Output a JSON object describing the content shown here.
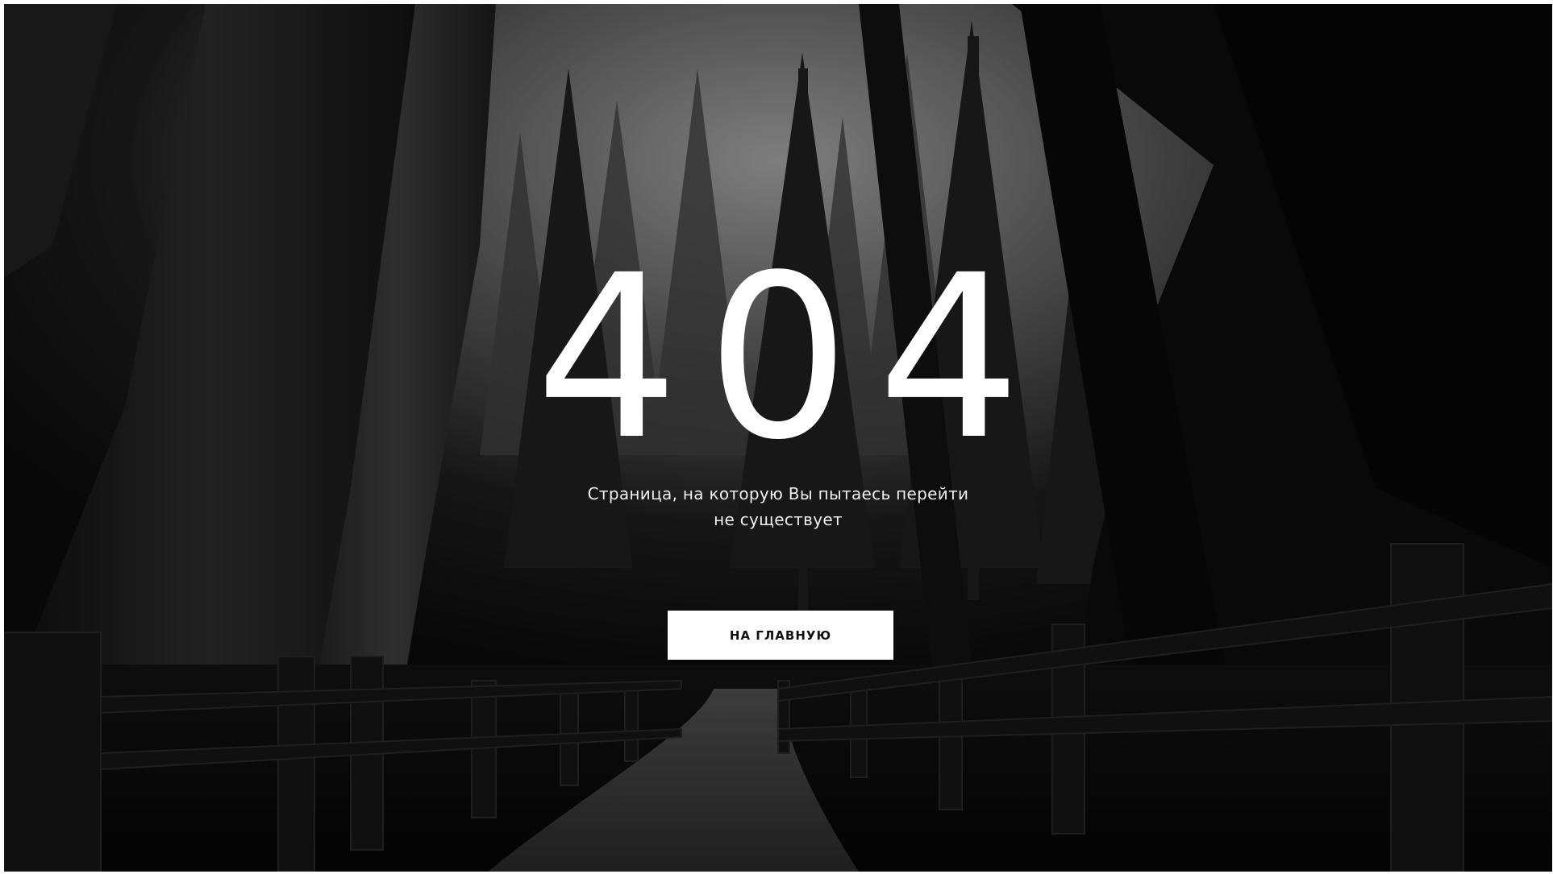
{
  "page": {
    "error_code": "404",
    "message_line1": "Страница, на которую Вы пытаесь перейти",
    "message_line2": "не существует",
    "home_button_label": "НА ГЛАВНУЮ"
  },
  "background": {
    "description_icon": "forest-path-photo",
    "tone": "grayscale"
  },
  "colors": {
    "text": "#ffffff",
    "button_bg": "#ffffff",
    "button_text": "#111111"
  }
}
